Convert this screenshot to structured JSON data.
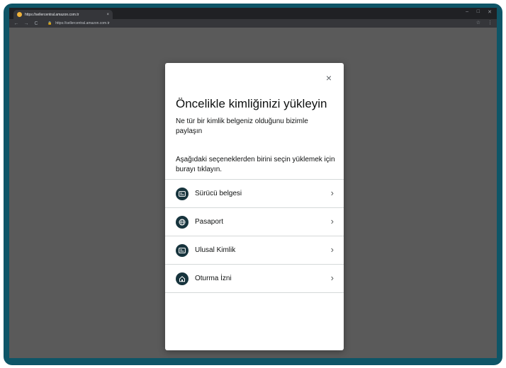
{
  "browser": {
    "tab_title": "https://sellercentral.amazon.com.tr",
    "tab_close": "×",
    "url": "https://sellercentral.amazon.com.tr",
    "lock_glyph": "🔒",
    "back_glyph": "←",
    "forward_glyph": "→",
    "reload_glyph": "C",
    "minimize_glyph": "–",
    "maximize_glyph": "□",
    "close_glyph": "✕",
    "star_glyph": "☆",
    "menu_glyph": "⋮"
  },
  "modal": {
    "close_glyph": "×",
    "title": "Öncelikle kimliğinizi yükleyin",
    "paragraph1": "Ne tür bir kimlik belgeniz olduğunu bizimle paylaşın",
    "paragraph2": "Aşağıdaki seçeneklerden birini seçin yüklemek için burayı tıklayın.",
    "options": [
      {
        "label": "Sürücü belgesi",
        "icon": "id-card-icon"
      },
      {
        "label": "Pasaport",
        "icon": "globe-icon"
      },
      {
        "label": "Ulusal Kimlik",
        "icon": "id-card-icon"
      },
      {
        "label": "Oturma İzni",
        "icon": "home-icon"
      }
    ],
    "chevron_glyph": "›"
  },
  "colors": {
    "frame": "#0e5567",
    "overlay": "#5a5a5a",
    "icon_circle": "#17343d"
  }
}
